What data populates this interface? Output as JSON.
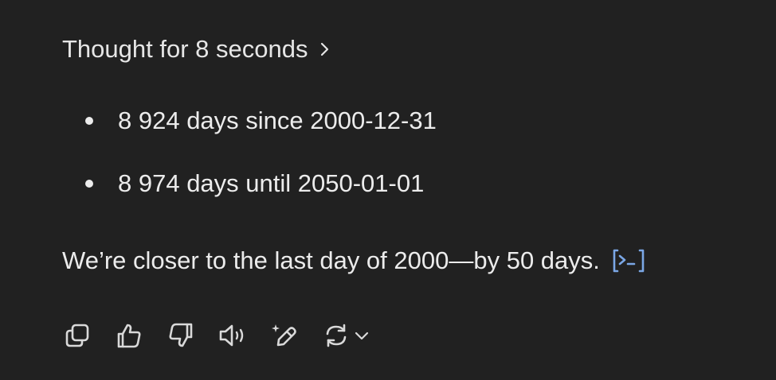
{
  "thought": {
    "label": "Thought for 8 seconds",
    "chevron_icon": "chevron-right-icon"
  },
  "bullets": [
    {
      "text": "8 924 days since 2000-12-31"
    },
    {
      "text": "8 974 days until 2050-01-01"
    }
  ],
  "answer": {
    "text": "We’re closer to the last day of 2000—by 50 days.",
    "code_badge_icon": "code-terminal-icon",
    "code_badge_color": "#7ba7e6"
  },
  "actions": [
    {
      "name": "copy",
      "icon": "copy-icon"
    },
    {
      "name": "good-response",
      "icon": "thumbs-up-icon"
    },
    {
      "name": "bad-response",
      "icon": "thumbs-down-icon"
    },
    {
      "name": "read-aloud",
      "icon": "speaker-icon"
    },
    {
      "name": "edit-canvas",
      "icon": "sparkle-pen-icon"
    },
    {
      "name": "regenerate",
      "icon": "refresh-icon"
    }
  ],
  "colors": {
    "background": "#212121",
    "text": "#ececec",
    "icon": "#d9d9d9",
    "accent": "#7ba7e6"
  }
}
